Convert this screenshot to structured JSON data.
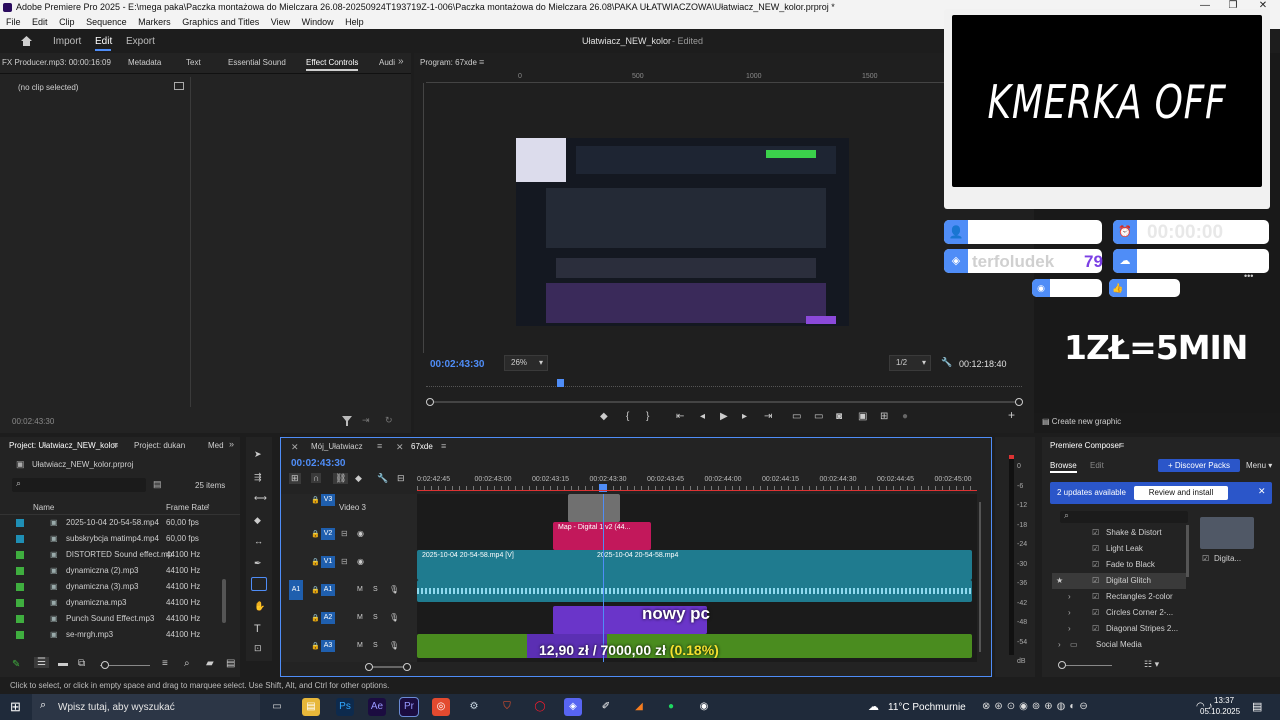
{
  "window": {
    "title": "Adobe Premiere Pro 2025 - E:\\mega paka\\Paczka montażowa do Mielczara 26.08-20250924T193719Z-1-006\\Paczka montażowa do Mielczara 26.08\\PAKA UŁATWIACZOWA\\Ułatwiacz_NEW_kolor.prproj *",
    "controls": [
      "—",
      "❐",
      "✕"
    ]
  },
  "menu": [
    "File",
    "Edit",
    "Clip",
    "Sequence",
    "Markers",
    "Graphics and Titles",
    "View",
    "Window",
    "Help"
  ],
  "appbar": {
    "tabs": [
      "Import",
      "Edit",
      "Export"
    ],
    "active_tab": "Edit",
    "project_name": "Ułatwiacz_NEW_kolor",
    "project_status": "- Edited"
  },
  "source_panel": {
    "tabs": [
      "FX Producer.mp3: 00:00:16:09",
      "Metadata",
      "Text",
      "Essential Sound",
      "Effect Controls",
      "Audi"
    ],
    "active_tab": "Effect Controls",
    "no_clip": "(no clip selected)",
    "timecode": "00:02:43:30"
  },
  "program": {
    "title": "Program: 67xde",
    "ruler_labels": [
      "0",
      "500",
      "1000",
      "1500",
      "2000"
    ],
    "timecode": "00:02:43:30",
    "zoom": "26%",
    "resolution": "1/2",
    "duration": "00:12:18:40",
    "playhead_fraction": 0.22
  },
  "overlays": {
    "camera_text": "KMERKA OFF",
    "timer": "00:00:00",
    "username": "terfoludek",
    "user_count": "79",
    "price": "1ZŁ=5MIN",
    "create_graphic": "Create new graphic",
    "subtitle": "nowy pc",
    "donation_amount": "12,90 zł",
    "donation_goal": "/ 7000,00 zł",
    "donation_pct": "(0.18%)"
  },
  "project_panel": {
    "tabs": [
      "Project: Ułatwiacz_NEW_kolor",
      "Project: dukan",
      "Med"
    ],
    "file": "Ułatwiacz_NEW_kolor.prproj",
    "items_count": "25 items",
    "col_name": "Name",
    "col_framerate": "Frame Rate",
    "rows": [
      {
        "name": "2025-10-04 20-54-58.mp4",
        "rate": "60,00 fps",
        "color": "#1f8fb5"
      },
      {
        "name": "subskrybcja matimp4.mp4",
        "rate": "60,00 fps",
        "color": "#1f8fb5"
      },
      {
        "name": "DISTORTED Sound effect.mp",
        "rate": "44100 Hz",
        "color": "#3fae3f"
      },
      {
        "name": "dynamiczna (2).mp3",
        "rate": "44100 Hz",
        "color": "#3fae3f"
      },
      {
        "name": "dynamiczna (3).mp3",
        "rate": "44100 Hz",
        "color": "#3fae3f"
      },
      {
        "name": "dynamiczna.mp3",
        "rate": "44100 Hz",
        "color": "#3fae3f"
      },
      {
        "name": "Punch Sound Effect.mp3",
        "rate": "44100 Hz",
        "color": "#3fae3f"
      },
      {
        "name": "se-mrgh.mp3",
        "rate": "44100 Hz",
        "color": "#3fae3f"
      }
    ]
  },
  "timeline": {
    "tabs": [
      "Mój_Ułatwiacz",
      "67xde"
    ],
    "active_tab": "67xde",
    "timecode": "00:02:43:30",
    "ruler": [
      "0:02:42:45",
      "00:02:43:00",
      "00:02:43:15",
      "00:02:43:30",
      "00:02:43:45",
      "00:02:44:00",
      "00:02:44:15",
      "00:02:44:30",
      "00:02:44:45",
      "00:02:45:00"
    ],
    "tracks": {
      "v3": "V3",
      "v3_name": "Video 3",
      "v2": "V2",
      "v1": "V1",
      "a1": "A1",
      "a2": "A2",
      "a3": "A3"
    },
    "clips": {
      "v2_clip": "Map - Digital 1 v2 (44...",
      "v1_left": "2025-10-04 20-54-58.mp4 [V]",
      "v1_right": "2025-10-04 20-54-58.mp4"
    },
    "meter_labels": [
      "0",
      "-6",
      "-12",
      "-18",
      "-24",
      "-30",
      "-36",
      "-42",
      "-48",
      "-54",
      "dB"
    ]
  },
  "composer": {
    "title": "Premiere Composer",
    "tabs": [
      "Browse",
      "Edit"
    ],
    "discover": "+ Discover Packs",
    "menu": "Menu",
    "updates": "2 updates available",
    "review": "Review and install",
    "items": [
      "Shake & Distort",
      "Light Leak",
      "Fade to Black",
      "Digital Glitch",
      "Rectangles 2-color",
      "Circles Corner 2-...",
      "Diagonal Stripes 2...",
      "Social Media"
    ],
    "selected_item": "Digital Glitch",
    "preview_label": "Digita..."
  },
  "status_bar": "Click to select, or click in empty space and drag to marquee select. Use Shift, Alt, and Ctrl for other options.",
  "taskbar": {
    "search": "Wpisz tutaj, aby wyszukać",
    "weather": "11°C  Pochmurnie",
    "time": "13:37",
    "date": "05.10.2025"
  }
}
